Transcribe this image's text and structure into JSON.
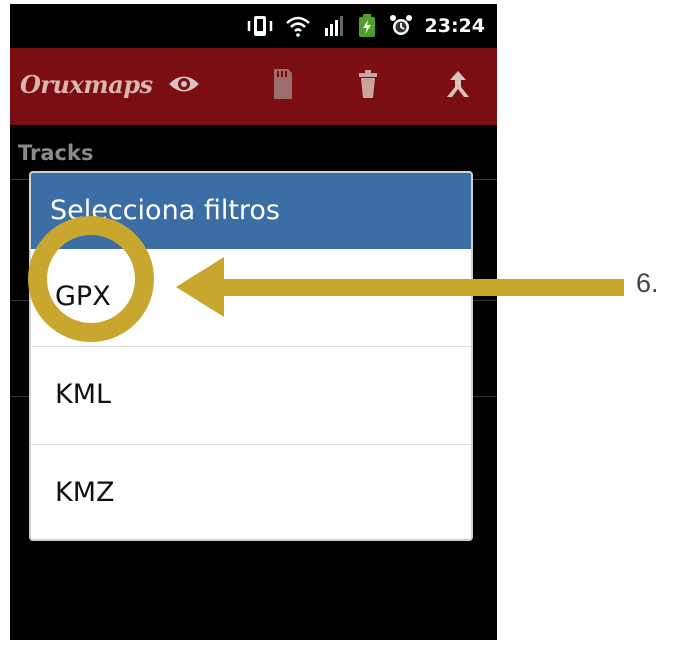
{
  "status_bar": {
    "time": "23:24",
    "icons": [
      "vibrate-icon",
      "wifi-icon",
      "signal-icon",
      "battery-icon",
      "alarm-icon"
    ]
  },
  "action_bar": {
    "app_logo_text": "Oruxmaps",
    "actions": [
      "eye-icon",
      "sd-card-icon",
      "trash-icon",
      "share-icon"
    ],
    "background_color": "#7a0e12"
  },
  "list": {
    "section_title": "Tracks"
  },
  "dialog": {
    "title": "Selecciona filtros",
    "header_color": "#3b6ea5",
    "options": [
      "GPX",
      "KML",
      "KMZ"
    ]
  },
  "annotation": {
    "step_label": "6.",
    "color": "#c9a72e",
    "target_option": "GPX"
  }
}
